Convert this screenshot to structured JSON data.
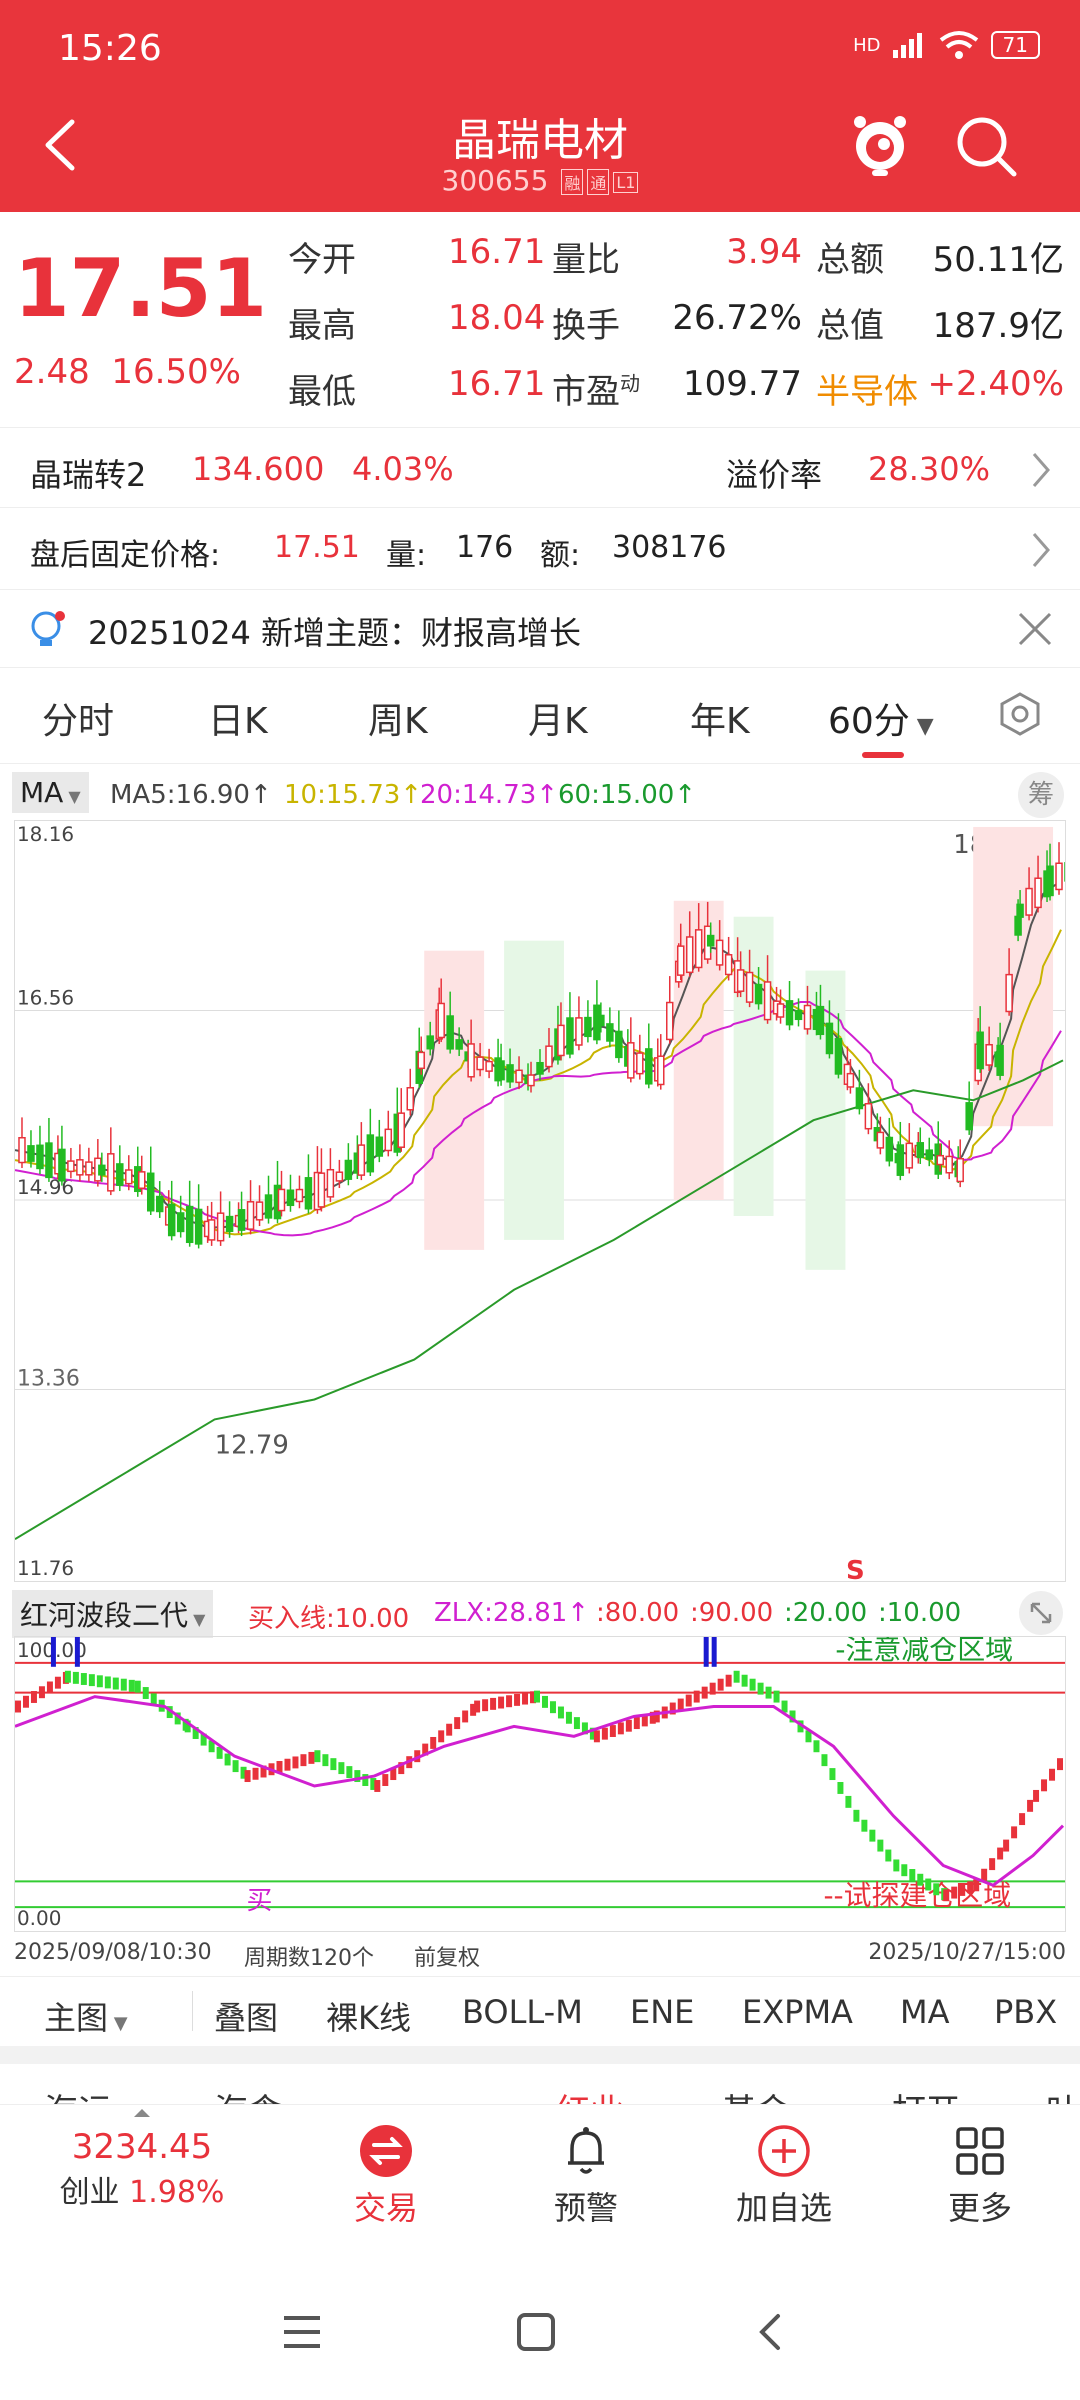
{
  "status_bar": {
    "time": "15:26",
    "battery": "71",
    "network": "HD"
  },
  "header": {
    "title": "晶瑞电材",
    "code": "300655",
    "tags": [
      "融",
      "通",
      "L1"
    ]
  },
  "quote": {
    "price": "17.51",
    "change": "2.48",
    "change_pct": "16.50%",
    "rows": [
      {
        "l1": "今开",
        "v1": "16.71",
        "l2": "量比",
        "v2": "3.94",
        "l3": "总额",
        "v3": "50.11亿"
      },
      {
        "l1": "最高",
        "v1": "18.04",
        "l2": "换手",
        "v2": "26.72%",
        "l3": "总值",
        "v3": "187.9亿"
      },
      {
        "l1": "最低",
        "v1": "16.71",
        "l2": "市盈",
        "l2_sup": "动",
        "v2": "109.77",
        "l3": "半导体",
        "v3": "+2.40%"
      }
    ]
  },
  "convertible": {
    "name": "晶瑞转2",
    "price": "134.600",
    "pct": "4.03%",
    "premium_label": "溢价率",
    "premium": "28.30%"
  },
  "after_hours": {
    "label": "盘后固定价格:",
    "price": "17.51",
    "vol_label": "量:",
    "vol": "176",
    "amt_label": "额:",
    "amt": "308176"
  },
  "notice": {
    "text": "20251024 新增主题：财报高增长"
  },
  "tabs": [
    "分时",
    "日K",
    "周K",
    "月K",
    "年K",
    "60分"
  ],
  "ma_header": {
    "dropdown": "MA",
    "ma5": "MA5:16.90↑",
    "ma10": "10:15.73↑",
    "ma20": "20:14.73↑",
    "ma60": "60:15.00↑",
    "chip": "筹"
  },
  "main_chart": {
    "y_labels": [
      "18.16",
      "16.56",
      "14.96",
      "11.76"
    ],
    "high_label": "18.04",
    "low_label": "12.79",
    "left_label": "13.36",
    "colors": {
      "up": "#e8323b",
      "down": "#33cc33",
      "ma5": "#555555",
      "ma10": "#c8b400",
      "ma20": "#d020d0",
      "ma60": "#2a9a2a"
    }
  },
  "sub_header": {
    "name": "红河波段二代",
    "buy": "买入线:10.00",
    "zlx": "ZLX:28.81↑",
    "v80": ":80.00",
    "v90": ":90.00",
    "v20": ":20.00",
    "v10": ":10.00"
  },
  "sub_chart": {
    "top_label": "100.00",
    "bottom_label": "0.00",
    "warn_text": "-注意减仓区域",
    "build_text": "--试探建仓区域",
    "buy_mark": "买",
    "sell_mark": "S"
  },
  "chart_footer": {
    "start": "2025/09/08/10:30",
    "period": "周期数120个",
    "adj": "前复权",
    "end": "2025/10/27/15:00"
  },
  "indicators": [
    "主图",
    "叠图",
    "裸K线",
    "BOLL-M",
    "ENE",
    "EXPMA",
    "MA",
    "PBX"
  ],
  "peek_row": [
    "海运",
    "海食",
    "红业",
    "基金",
    "打开",
    "叶"
  ],
  "bottom_nav": {
    "index_value": "3234.45",
    "index_name": "创业",
    "index_pct": "1.98%",
    "items": [
      "交易",
      "预警",
      "加自选",
      "更多"
    ]
  }
}
